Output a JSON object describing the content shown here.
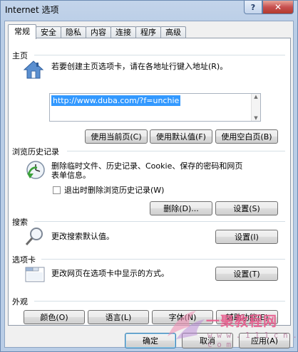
{
  "window": {
    "title": "Internet 选项",
    "help_glyph": "?",
    "close_glyph": "✕"
  },
  "tabs": [
    {
      "label": "常规",
      "active": true
    },
    {
      "label": "安全",
      "active": false
    },
    {
      "label": "隐私",
      "active": false
    },
    {
      "label": "内容",
      "active": false
    },
    {
      "label": "连接",
      "active": false
    },
    {
      "label": "程序",
      "active": false
    },
    {
      "label": "高级",
      "active": false
    }
  ],
  "homepage": {
    "section": "主页",
    "description": "若要创建主页选项卡，请在各地址行键入地址(R)。",
    "url": "http://www.duba.com/?f=unchie",
    "icon": "house-icon",
    "buttons": [
      "使用当前页(C)",
      "使用默认值(F)",
      "使用空白页(B)"
    ]
  },
  "history": {
    "section": "浏览历史记录",
    "description_line1": "删除临时文件、历史记录、Cookie、保存的密码和网页",
    "description_line2": "表单信息。",
    "icon": "history-clock-icon",
    "checkbox_label": "退出时删除浏览历史记录(W)",
    "checkbox_checked": false,
    "delete_button": "删除(D)...",
    "settings_button": "设置(S)"
  },
  "search": {
    "section": "搜索",
    "description": "更改搜索默认值。",
    "icon": "magnifier-icon",
    "settings_button": "设置(I)"
  },
  "tabs_section": {
    "section": "选项卡",
    "description": "更改网页在选项卡中显示的方式。",
    "icon": "tabbed-window-icon",
    "settings_button": "设置(T)"
  },
  "appearance": {
    "section": "外观",
    "buttons": [
      "颜色(O)",
      "语言(L)",
      "字体(N)",
      "辅助功能(E)"
    ]
  },
  "footer": {
    "ok": "确定",
    "cancel": "取消",
    "apply": "应用(A)"
  },
  "watermark": {
    "text": "一聚教程网",
    "sub": "w w w . 1 1 1 c n . c o m"
  },
  "colors": {
    "selection": "#3399ff",
    "close_button": "#c75050",
    "window_frame": "#b9cde6"
  }
}
